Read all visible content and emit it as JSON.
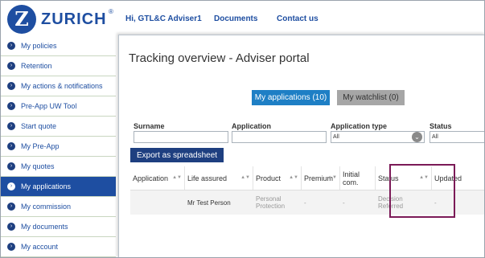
{
  "brand": {
    "name": "ZURICH",
    "logo_letter": "Z",
    "reg_mark": "®"
  },
  "top_nav": {
    "greeting": "Hi, GTL&C Adviser1",
    "documents": "Documents",
    "contact": "Contact us"
  },
  "sidebar": {
    "items": [
      {
        "label": "My policies"
      },
      {
        "label": "Retention"
      },
      {
        "label": "My actions & notifications"
      },
      {
        "label": "Pre-App UW Tool"
      },
      {
        "label": "Start quote"
      },
      {
        "label": "My Pre-App"
      },
      {
        "label": "My quotes"
      },
      {
        "label": "My applications",
        "active": true
      },
      {
        "label": "My commission"
      },
      {
        "label": "My documents"
      },
      {
        "label": "My account"
      }
    ]
  },
  "main": {
    "title": "Tracking overview - Adviser portal",
    "tabs": {
      "applications": "My applications (10)",
      "watchlist": "My watchlist (0)"
    },
    "filters": {
      "surname_label": "Surname",
      "surname_value": "",
      "application_label": "Application",
      "application_value": "",
      "type_label": "Application type",
      "type_value": "All",
      "status_label": "Status",
      "status_value": "All"
    },
    "export_label": "Export as spreadsheet",
    "table": {
      "headers": [
        "Application",
        "Life assured",
        "Product",
        "Premium",
        "Initial com.",
        "Status",
        "Updated"
      ],
      "rows": [
        [
          "",
          "Mr Test Person",
          "Personal Protection",
          "-",
          "-",
          "Decision Referred",
          "-"
        ]
      ]
    }
  },
  "colors": {
    "brand_blue": "#1e4ea1",
    "tab_blue": "#1e7fc5",
    "highlight": "#7b1a57"
  }
}
